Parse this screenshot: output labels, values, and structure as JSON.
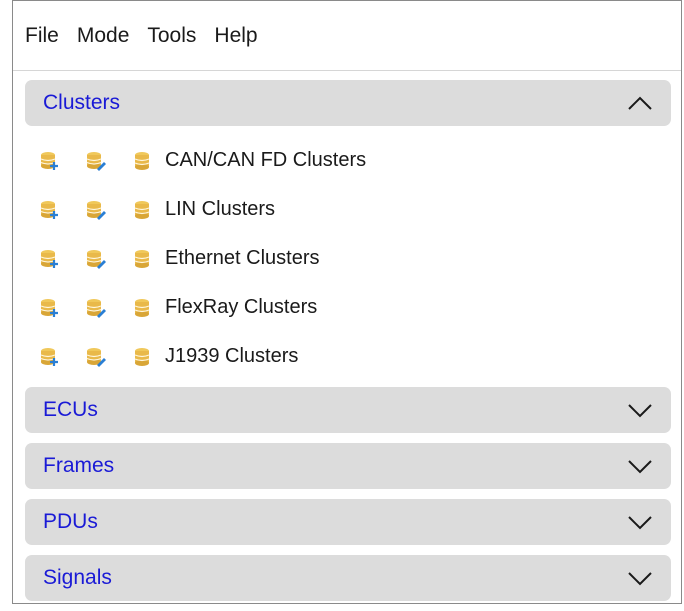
{
  "menu": [
    "File",
    "Mode",
    "Tools",
    "Help"
  ],
  "sections": {
    "clusters": {
      "title": "Clusters",
      "expanded": true,
      "chevron": "chevron-up-icon"
    },
    "ecus": {
      "title": "ECUs",
      "expanded": false,
      "chevron": "chevron-down-icon"
    },
    "frames": {
      "title": "Frames",
      "expanded": false,
      "chevron": "chevron-down-icon"
    },
    "pdus": {
      "title": "PDUs",
      "expanded": false,
      "chevron": "chevron-down-icon"
    },
    "signals": {
      "title": "Signals",
      "expanded": false,
      "chevron": "chevron-down-icon"
    }
  },
  "clusters": [
    {
      "label": "CAN/CAN FD Clusters",
      "icons": [
        "database-add-icon",
        "database-edit-icon",
        "database-icon"
      ]
    },
    {
      "label": "LIN Clusters",
      "icons": [
        "database-add-icon",
        "database-edit-icon",
        "database-icon"
      ]
    },
    {
      "label": "Ethernet Clusters",
      "icons": [
        "database-add-icon",
        "database-edit-icon",
        "database-icon"
      ]
    },
    {
      "label": "FlexRay Clusters",
      "icons": [
        "database-add-icon",
        "database-edit-icon",
        "database-icon"
      ]
    },
    {
      "label": "J1939 Clusters",
      "icons": [
        "database-add-icon",
        "database-edit-icon",
        "database-icon"
      ]
    }
  ],
  "colors": {
    "section_title": "#1a1ad6",
    "section_header_bg": "#dcdcdc",
    "database_icon": "#e9b94a",
    "add_badge": "#2a7fd4"
  }
}
